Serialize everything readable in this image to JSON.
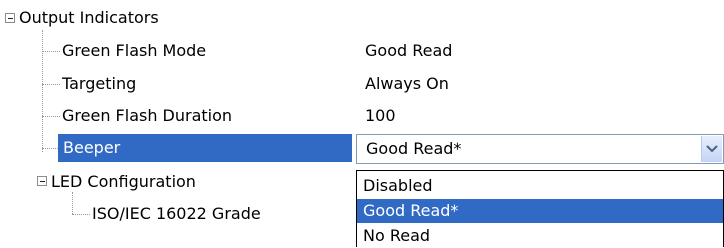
{
  "tree": {
    "root_label": "Output Indicators",
    "rows": [
      {
        "label": "Green Flash Mode",
        "value": "Good Read"
      },
      {
        "label": "Targeting",
        "value": "Always On"
      },
      {
        "label": "Green Flash Duration",
        "value": "100"
      }
    ],
    "selected_label": "Beeper",
    "led_configuration": "LED Configuration",
    "iso_grade": "ISO/IEC 16022 Grade"
  },
  "beeper_combo": {
    "selected_value": "Good Read*",
    "options": [
      "Disabled",
      "Good Read*",
      "No Read"
    ],
    "highlighted_index": 1
  },
  "colors": {
    "selection": "#316ac5",
    "dotted_line": "#9a9a9a"
  }
}
